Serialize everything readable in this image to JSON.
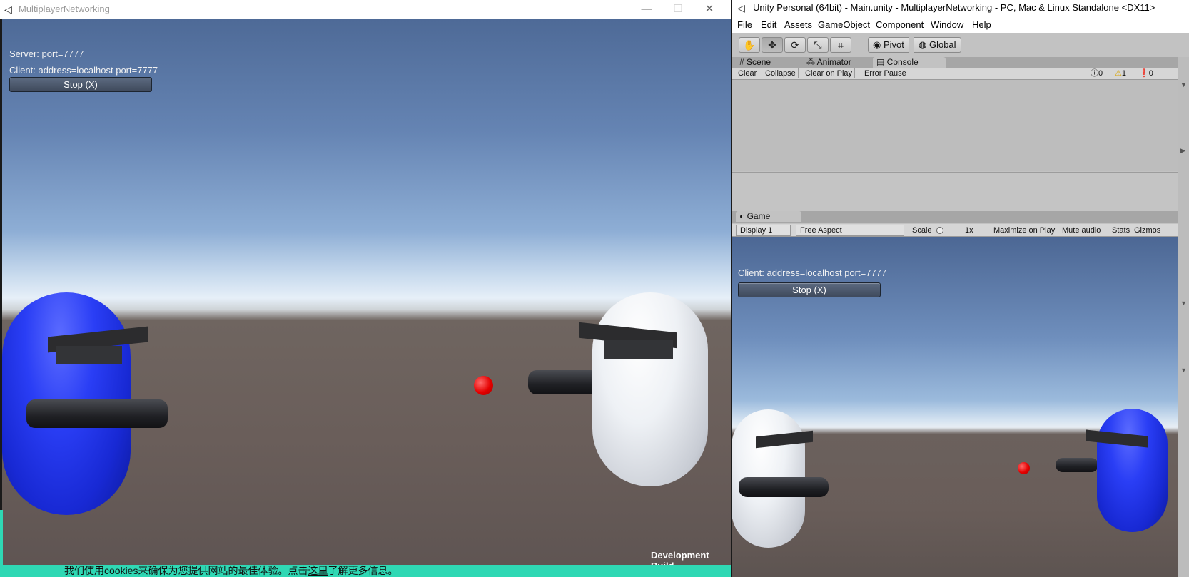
{
  "standalone": {
    "title": "MultiplayerNetworking",
    "controls": {
      "minimize": "—",
      "maximize": "☐",
      "close": "✕"
    },
    "hud": {
      "server_text": "Server: port=7777",
      "client_text": "Client: address=localhost port=7777",
      "stop_label": "Stop (X)"
    },
    "dev_build": "Development Build",
    "cookie_text_1": "我们使用cookies来确保为您提供网站的最佳体验。点击",
    "cookie_link": "这里",
    "cookie_text_2": "了解更多信息。"
  },
  "editor": {
    "title": "Unity Personal (64bit) - Main.unity - MultiplayerNetworking - PC, Mac & Linux Standalone <DX11>",
    "menu": [
      "File",
      "Edit",
      "Assets",
      "GameObject",
      "Component",
      "Window",
      "Help"
    ],
    "toolbar": {
      "pivot": "Pivot",
      "global": "Global"
    },
    "tabs": {
      "scene": "Scene",
      "animator": "Animator",
      "console": "Console"
    },
    "console_toolbar": {
      "clear": "Clear",
      "collapse": "Collapse",
      "clear_on_play": "Clear on Play",
      "error_pause": "Error Pause",
      "info_count": "0",
      "warning_count": "1",
      "error_count": "0"
    },
    "game": {
      "tab": "Game",
      "display": "Display 1",
      "aspect": "Free Aspect",
      "scale_label": "Scale",
      "scale_value": "1x",
      "maximize_on_play": "Maximize on Play",
      "mute_audio": "Mute audio",
      "stats": "Stats",
      "gizmos": "Gizmos",
      "hud": {
        "client_text": "Client: address=localhost port=7777",
        "stop_label": "Stop (X)"
      }
    }
  },
  "colors": {
    "player_blue": "#1f33e6",
    "player_white": "#e8ecf2",
    "bullet_red": "#e40000",
    "cookie_bar": "#2fd8b4"
  }
}
